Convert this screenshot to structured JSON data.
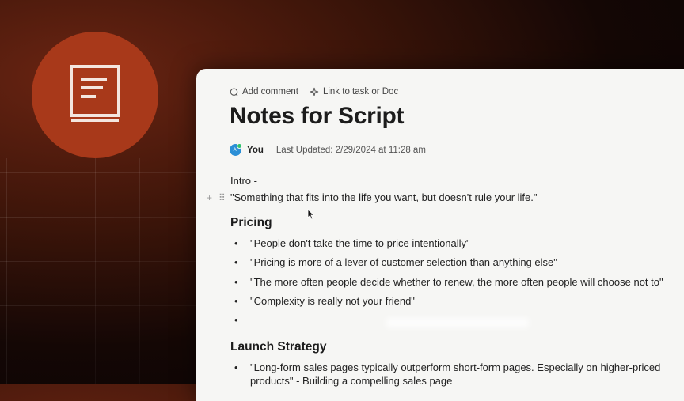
{
  "toolbar": {
    "add_comment": "Add comment",
    "link_task": "Link to task or Doc"
  },
  "doc": {
    "title": "Notes for Script",
    "author": "You",
    "avatar_initials": "AI",
    "last_updated": "Last Updated: 2/29/2024 at 11:28 am",
    "intro_label": "Intro -",
    "intro_quote": "\"Something that fits into the life you want, but doesn't rule your life.\""
  },
  "sections": {
    "pricing": {
      "heading": "Pricing",
      "bullets": [
        "\"People don't take the time to price intentionally\"",
        "\"Pricing is more of a lever of customer selection than anything else\"",
        "\"The more often people decide whether to renew, the more often people will choose not to\"",
        "\"Complexity is really not your friend\"",
        ""
      ]
    },
    "launch": {
      "heading": "Launch Strategy",
      "bullets": [
        "\"Long-form sales pages typically outperform short-form pages. Especially on higher-priced",
        "products\" - Building a compelling sales page"
      ]
    }
  },
  "colors": {
    "accent_orange": "#a8391a",
    "avatar_blue": "#2b8fd6"
  },
  "icons": {
    "logo": "document-icon",
    "comment": "comment-icon",
    "link": "sparkle-link-icon"
  }
}
